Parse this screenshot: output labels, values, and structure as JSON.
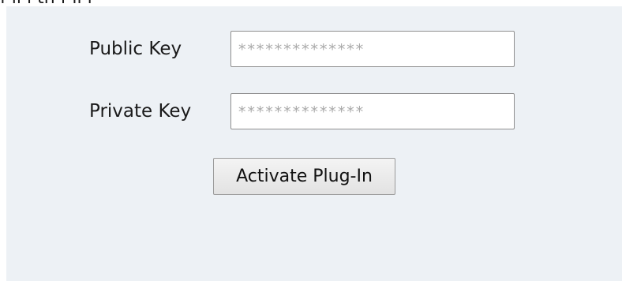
{
  "top_fragment": "f   ll      i  th  f ll  i",
  "form": {
    "public_key": {
      "label": "Public Key",
      "value": "**************"
    },
    "private_key": {
      "label": "Private Key",
      "value": "**************"
    },
    "activate_label": "Activate Plug-In"
  }
}
